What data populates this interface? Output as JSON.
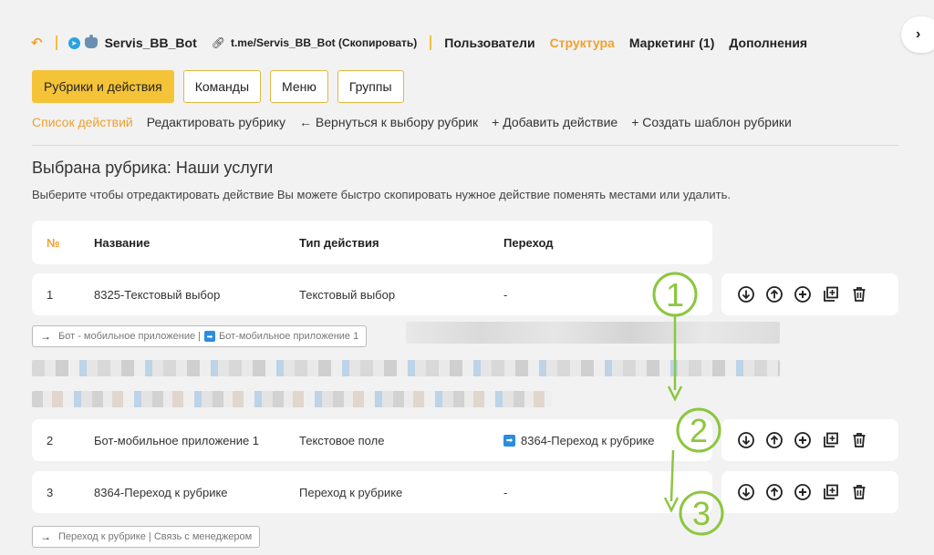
{
  "topbar": {
    "bot_name": "Servis_BB_Bot",
    "bot_link": "t.me/Servis_BB_Bot (Скопировать)",
    "nav": [
      {
        "label": "Пользователи",
        "active": false
      },
      {
        "label": "Структура",
        "active": true
      },
      {
        "label": "Маркетинг (1)",
        "active": false
      },
      {
        "label": "Дополнения",
        "active": false
      }
    ]
  },
  "tabs": [
    {
      "label": "Рубрики и действия",
      "active": true
    },
    {
      "label": "Команды",
      "active": false
    },
    {
      "label": "Меню",
      "active": false
    },
    {
      "label": "Группы",
      "active": false
    }
  ],
  "subnav": [
    {
      "label": "Список действий",
      "active": true
    },
    {
      "label": "Редактировать рубрику",
      "active": false
    },
    {
      "label": "← Вернуться к выбору рубрик",
      "active": false
    },
    {
      "label": "+ Добавить действие",
      "active": false
    },
    {
      "label": "+ Создать шаблон рубрики",
      "active": false
    }
  ],
  "heading": "Выбрана рубрика: Наши услуги",
  "description": "Выберите чтобы отредактировать действие Вы можете быстро скопировать нужное действие поменять местами или удалить.",
  "table": {
    "headers": [
      "№",
      "Название",
      "Тип действия",
      "Переход"
    ],
    "rows": [
      {
        "num": "1",
        "name": "8325-Текстовый выбор",
        "type": "Текстовый выбор",
        "transition": "-",
        "has_link_icon": false
      },
      {
        "num": "2",
        "name": "Бот-мобильное приложение 1",
        "type": "Текстовое поле",
        "transition": "8364-Переход к рубрике",
        "has_link_icon": true
      },
      {
        "num": "3",
        "name": "8364-Переход к рубрике",
        "type": "Переход к рубрике",
        "transition": "-",
        "has_link_icon": false
      }
    ]
  },
  "chips": {
    "row1_part1": "Бот - мобильное приложение |",
    "row1_part2": "Бот-мобильное приложение 1",
    "row3": "Переход к рубрике | Связь с менеджером"
  },
  "annotations": [
    "1",
    "2",
    "3"
  ],
  "colors": {
    "accent": "#f0a030",
    "tab_active": "#f5c338",
    "link_blue": "#2a8de0",
    "annotation_green": "#8cc63f"
  },
  "icons": [
    "move-down-icon",
    "move-up-icon",
    "add-icon",
    "copy-icon",
    "delete-icon"
  ]
}
